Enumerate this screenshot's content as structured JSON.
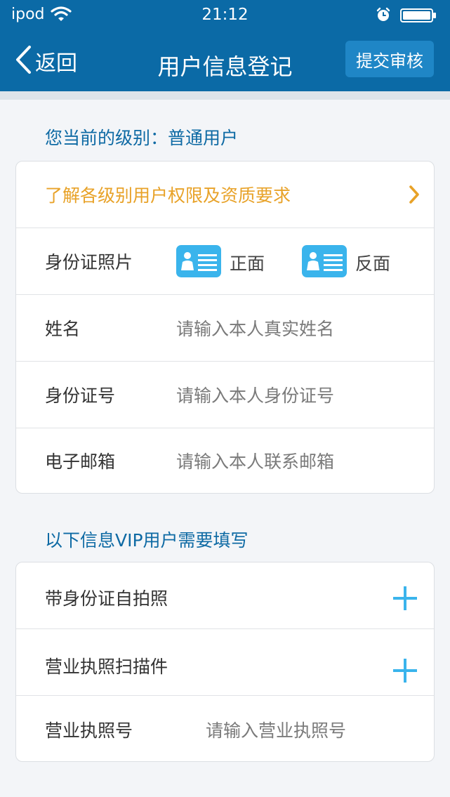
{
  "status_bar": {
    "carrier": "ipod",
    "time": "21:12",
    "icons": [
      "wifi-icon",
      "alarm-icon",
      "battery-icon"
    ]
  },
  "nav": {
    "back_label": "返回",
    "title": "用户信息登记",
    "submit_label": "提交审核"
  },
  "level": {
    "text": "您当前的级别：普通用户"
  },
  "card1": {
    "permissions_link": "了解各级别用户权限及资质要求",
    "id_photo": {
      "label": "身份证照片",
      "front": "正面",
      "back": "反面"
    },
    "name": {
      "label": "姓名",
      "placeholder": "请输入本人真实姓名"
    },
    "id_number": {
      "label": "身份证号",
      "placeholder": "请输入本人身份证号"
    },
    "email": {
      "label": "电子邮箱",
      "placeholder": "请输入本人联系邮箱"
    }
  },
  "vip": {
    "title": "以下信息VIP用户需要填写",
    "selfie": {
      "label": "带身份证自拍照"
    },
    "license_scan": {
      "label": "营业执照扫描件"
    },
    "license_number": {
      "label": "营业执照号",
      "placeholder": "请输入营业执照号"
    }
  },
  "colors": {
    "header": "#0b6aa6",
    "accent_text": "#0e6aa4",
    "link_orange": "#e8a228",
    "icon_blue": "#3ab4ec"
  }
}
